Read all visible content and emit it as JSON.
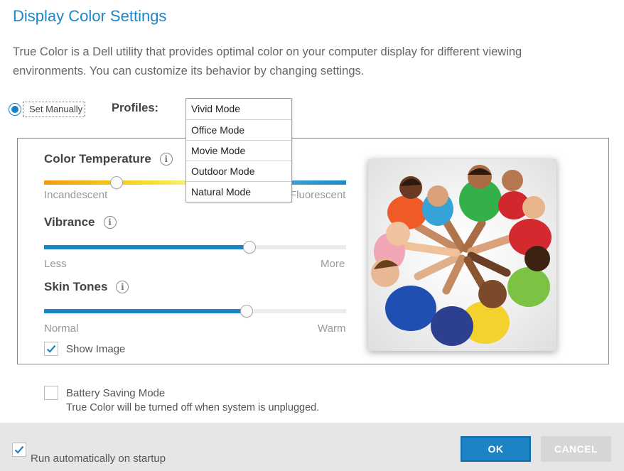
{
  "title": "Display Color Settings",
  "description": "True Color is a Dell utility that provides optimal color on your computer display for different viewing environments.  You can customize its behavior by changing settings.",
  "mode": {
    "label": "Set Manually",
    "selected": true
  },
  "profiles": {
    "label": "Profiles:",
    "options": [
      "Vivid Mode",
      "Office Mode",
      "Movie Mode",
      "Outdoor Mode",
      "Natural Mode"
    ]
  },
  "sliders": {
    "color_temperature": {
      "label": "Color Temperature",
      "min_label": "Incandescent",
      "max_label": "Fluorescent",
      "value": 0.24
    },
    "vibrance": {
      "label": "Vibrance",
      "min_label": "Less",
      "max_label": "More",
      "value": 0.68
    },
    "skin_tones": {
      "label": "Skin Tones",
      "min_label": "Normal",
      "max_label": "Warm",
      "value": 0.67
    }
  },
  "show_image": {
    "label": "Show Image",
    "checked": true
  },
  "battery": {
    "label": "Battery Saving Mode",
    "note": "True Color  will be turned off when system is unplugged.",
    "checked": false
  },
  "footer": {
    "startup_label": "Run automatically on startup",
    "startup_checked": true,
    "ok_label": "OK",
    "cancel_label": "CANCEL"
  },
  "colors": {
    "accent": "#1c83c4",
    "title": "#1e86c7",
    "footer_bg": "#e6e6e6"
  }
}
